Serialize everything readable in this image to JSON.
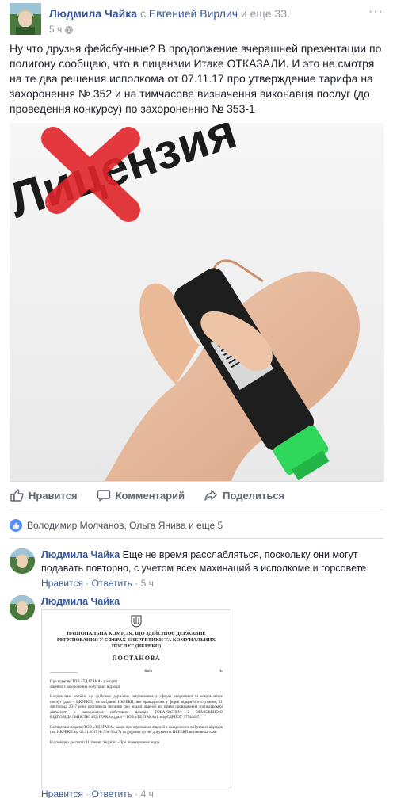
{
  "post": {
    "author": "Людмила Чайка",
    "with_text": "с",
    "with_name": "Евгенией Вирлич",
    "and_more": "и еще 33.",
    "time": "5 ч",
    "more_icon": "more-dots-icon",
    "text": "Ну что друзья фейсбучные? В продолжение вчерашней презентации по полигону сообщаю, что в лицензии Итаке ОТКАЗАЛИ. И это не смотря на те два решения исполкома от 07.11.17 про утверждение тарифа на захоронення № 352 и на тимчасове визначення виконавця послуг (до проведення конкурсу) по захороненню № 353-1",
    "image": {
      "word": "Лицензия",
      "colors": {
        "cross": "#e0242b",
        "marker": "#2fd85a"
      }
    }
  },
  "actions": {
    "like": "Нравится",
    "comment": "Комментарий",
    "share": "Поделиться"
  },
  "reactions": {
    "names": "Володимир Молчанов, Ольга Янива и еще 5"
  },
  "comments": [
    {
      "author": "Людмила Чайка",
      "text": "Еще не время расслабляться, поскольку они могут подавать повторно, с учетом всех махинаций в исполкоме и горсовете",
      "like": "Нравится",
      "reply": "Ответить",
      "time": "5 ч"
    },
    {
      "author": "Людмила Чайка",
      "like": "Нравится",
      "reply": "Ответить",
      "time": "4 ч",
      "document": {
        "header": "НАЦІОНАЛЬНА КОМІСІЯ, ЩО ЗДІЙСНЮЄ ДЕРЖАВНЕ РЕГУЛЮВАННЯ У СФЕРАХ ЕНЕРГЕТИКИ ТА КОМУНАЛЬНИХ ПОСЛУГ (НКРЕКП)",
        "title": "ПОСТАНОВА",
        "place": "Київ",
        "number": "№",
        "subject": "Про відмову ТОВ «ТД ІТАКА» у видачі ліцензії з захоронення побутових відходів",
        "para1": "Національна комісія, що здійснює державне регулювання у сферах енергетики та комунальних послуг (далі – НКРЕКП), на засіданні НКРЕКП, яке проводилось у формі відкритого слухання, 21 листопада 2017 року розглянула питання про видачі ліцензії на право провадження господарської діяльності з захоронення побутових відходів ТОВАРИСТВУ З ОБМЕЖЕНОЮ ВІДПОВІДАЛЬНІСТЮ «ТД ІТАКА» (далі – ТОВ «ТД ІТАКА»), код ЄДРПОУ 37744287.",
        "para2": "На підставі поданої ТОВ «ТД ІТАКА» заяви про отримання ліцензії з захоронення побутових відходів (вх. НКРЕКП від 08.11.2017 № Л/ж-33/17) та доданих до неї документів НКРЕКП встановила таке.",
        "para3": "Відповідно до статті 11 Закону України «Про ліцензування видів"
      }
    }
  ]
}
